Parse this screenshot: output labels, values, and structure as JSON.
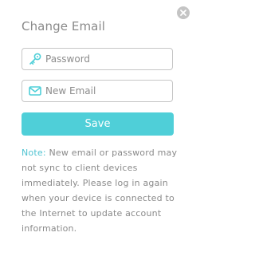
{
  "dialog": {
    "title": "Change Email",
    "close_icon": "close-icon"
  },
  "password_field": {
    "placeholder": "Password",
    "value": "",
    "icon": "key-icon"
  },
  "email_field": {
    "placeholder": "New Email",
    "value": "",
    "icon": "envelope-icon"
  },
  "save_button": {
    "label": "Save"
  },
  "note": {
    "label": "Note:",
    "text": " New email or password may not sync to client devices immediately. Please log in again when your device is connected to the Internet to update account information."
  },
  "colors": {
    "accent": "#4fcfd8",
    "note_label": "#4fc3d1",
    "text_gray": "#8a8a8a",
    "border": "#c6c6c6",
    "close_bg": "#c4c4c4"
  }
}
